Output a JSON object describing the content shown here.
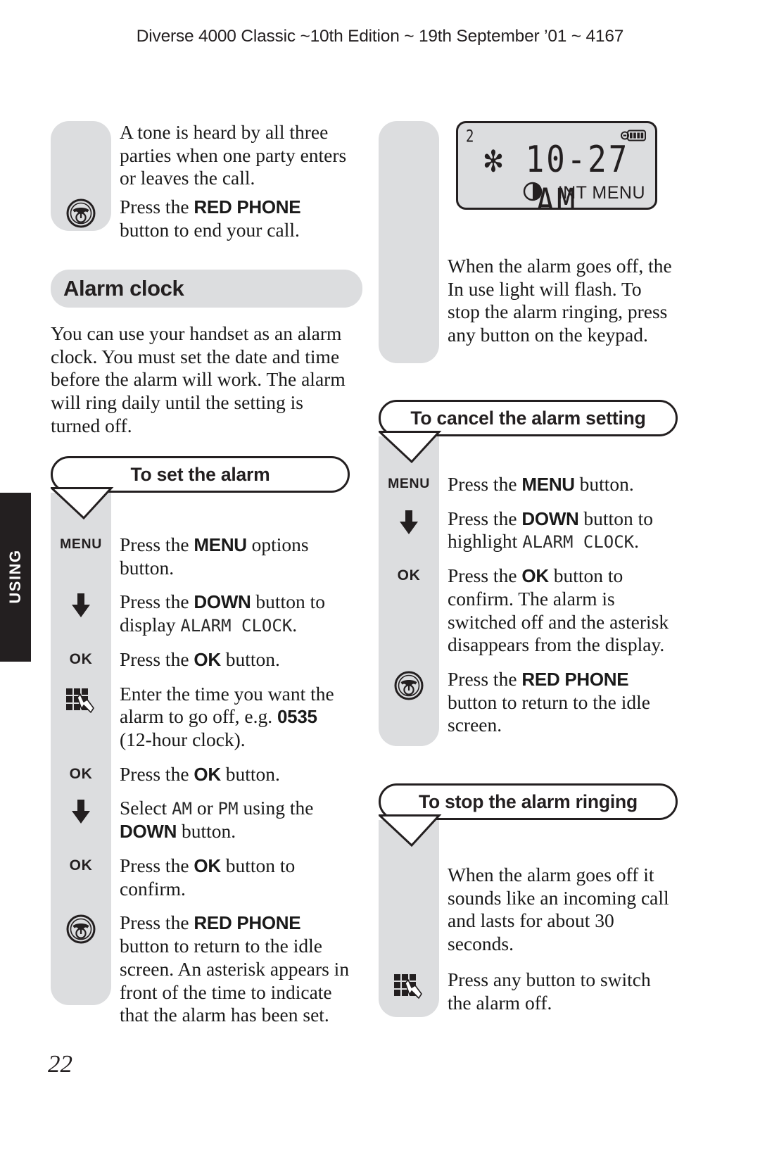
{
  "header": {
    "running_head": "Diverse 4000 Classic ~10th Edition ~ 19th September ’01 ~ 4167"
  },
  "side_tab": {
    "label": "USING"
  },
  "folio": {
    "page_number": "22"
  },
  "left_column": {
    "intro_block": {
      "paragraph": "A tone is heard by all three parties when one party enters or leaves the call.",
      "step": {
        "icon": "red-phone-icon",
        "text_before": "Press the ",
        "bold": "RED PHONE",
        "text_after": " button to end your call."
      }
    },
    "section_heading": "Alarm clock",
    "section_intro": "You can use your handset as an alarm clock. You must set the date and time before the alarm will work. The alarm will ring daily until the setting is turned off.",
    "callout": "To set the alarm",
    "steps": [
      {
        "marker": "MENU",
        "marker_type": "text",
        "parts": [
          {
            "t": "Press the ",
            "s": "roman"
          },
          {
            "t": "MENU",
            "s": "bold"
          },
          {
            "t": " options button.",
            "s": "roman"
          }
        ]
      },
      {
        "marker": "down-arrow-icon",
        "marker_type": "arrow",
        "parts": [
          {
            "t": "Press the ",
            "s": "roman"
          },
          {
            "t": "DOWN",
            "s": "bold"
          },
          {
            "t": " button to display ",
            "s": "roman"
          },
          {
            "t": "ALARM CLOCK",
            "s": "lcd"
          },
          {
            "t": ".",
            "s": "roman"
          }
        ]
      },
      {
        "marker": "OK",
        "marker_type": "text",
        "parts": [
          {
            "t": "Press the ",
            "s": "roman"
          },
          {
            "t": "OK",
            "s": "bold"
          },
          {
            "t": " button.",
            "s": "roman"
          }
        ]
      },
      {
        "marker": "keypad-icon",
        "marker_type": "keypad",
        "parts": [
          {
            "t": "Enter the time you want the alarm to go off, e.g. ",
            "s": "roman"
          },
          {
            "t": "0535",
            "s": "bold"
          },
          {
            "t": " (12-hour clock).",
            "s": "roman"
          }
        ]
      },
      {
        "marker": "OK",
        "marker_type": "text",
        "parts": [
          {
            "t": "Press the ",
            "s": "roman"
          },
          {
            "t": "OK",
            "s": "bold"
          },
          {
            "t": " button.",
            "s": "roman"
          }
        ]
      },
      {
        "marker": "down-arrow-icon",
        "marker_type": "arrow",
        "parts": [
          {
            "t": "Select ",
            "s": "roman"
          },
          {
            "t": "AM",
            "s": "lcd"
          },
          {
            "t": " or ",
            "s": "roman"
          },
          {
            "t": "PM",
            "s": "lcd"
          },
          {
            "t": " using the ",
            "s": "roman"
          },
          {
            "t": "DOWN",
            "s": "bold"
          },
          {
            "t": " button.",
            "s": "roman"
          }
        ]
      },
      {
        "marker": "OK",
        "marker_type": "text",
        "parts": [
          {
            "t": "Press the ",
            "s": "roman"
          },
          {
            "t": "OK",
            "s": "bold"
          },
          {
            "t": " button to confirm.",
            "s": "roman"
          }
        ]
      },
      {
        "marker": "red-phone-icon",
        "marker_type": "phone",
        "parts": [
          {
            "t": "Press the ",
            "s": "roman"
          },
          {
            "t": "RED PHONE",
            "s": "bold"
          },
          {
            "t": " button to return to the idle screen. An asterisk appears in front of the time to indicate that the alarm has been set.",
            "s": "roman"
          }
        ]
      }
    ]
  },
  "right_column": {
    "lcd": {
      "corner_number": "2",
      "battery_icon": "battery-full-icon",
      "time_display": "✻ 10-27 AM",
      "moon_icon": "half-moon-icon",
      "softkeys": "INT  MENU"
    },
    "lcd_caption": "When the alarm goes off, the In use light will flash. To stop the alarm ringing, press any button on the keypad.",
    "cancel": {
      "callout": "To cancel the alarm setting",
      "steps": [
        {
          "marker": "MENU",
          "marker_type": "text",
          "parts": [
            {
              "t": "Press the ",
              "s": "roman"
            },
            {
              "t": "MENU",
              "s": "bold"
            },
            {
              "t": " button.",
              "s": "roman"
            }
          ]
        },
        {
          "marker": "down-arrow-icon",
          "marker_type": "arrow",
          "parts": [
            {
              "t": "Press the ",
              "s": "roman"
            },
            {
              "t": "DOWN",
              "s": "bold"
            },
            {
              "t": " button to highlight ",
              "s": "roman"
            },
            {
              "t": "ALARM CLOCK",
              "s": "lcd"
            },
            {
              "t": ".",
              "s": "roman"
            }
          ]
        },
        {
          "marker": "OK",
          "marker_type": "text",
          "parts": [
            {
              "t": "Press the ",
              "s": "roman"
            },
            {
              "t": "OK",
              "s": "bold"
            },
            {
              "t": " button to confirm. The alarm is switched off and the asterisk disappears from the display.",
              "s": "roman"
            }
          ]
        },
        {
          "marker": "red-phone-icon",
          "marker_type": "phone",
          "parts": [
            {
              "t": "Press the ",
              "s": "roman"
            },
            {
              "t": "RED PHONE",
              "s": "bold"
            },
            {
              "t": " button to return to the idle screen.",
              "s": "roman"
            }
          ]
        }
      ]
    },
    "stop": {
      "callout": "To stop the alarm ringing",
      "steps": [
        {
          "marker": "",
          "marker_type": "none",
          "parts": [
            {
              "t": "When the alarm goes off it sounds like an incoming call and lasts for about 30 seconds.",
              "s": "roman"
            }
          ]
        },
        {
          "marker": "keypad-icon",
          "marker_type": "keypad",
          "parts": [
            {
              "t": "Press any button to switch the alarm off.",
              "s": "roman"
            }
          ]
        }
      ]
    }
  }
}
